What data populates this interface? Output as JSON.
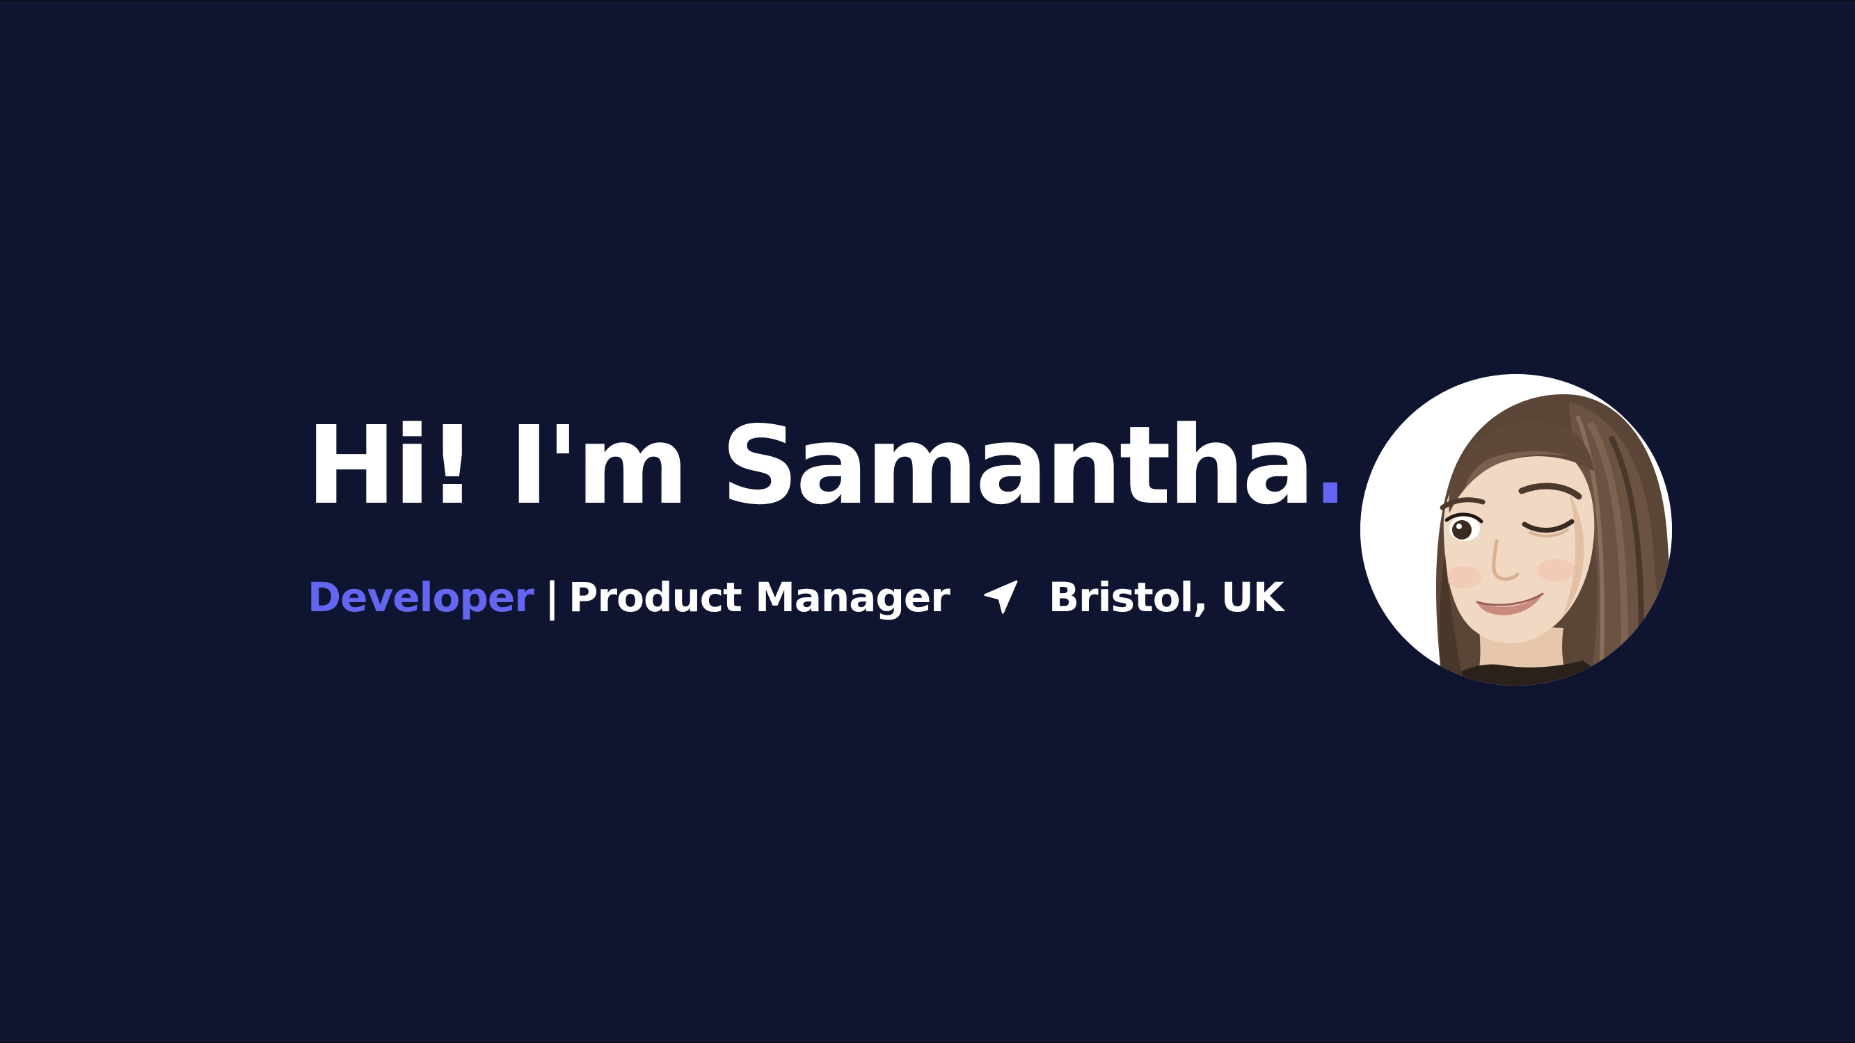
{
  "hero": {
    "greeting": "Hi! I'm Samantha",
    "greeting_dot": ".",
    "role_primary": "Developer",
    "separator": "|",
    "role_secondary": "Product Manager",
    "location": "Bristol, UK",
    "location_icon": "navigation-arrow-icon"
  },
  "avatar": {
    "icon": "memoji-avatar-winking"
  },
  "colors": {
    "background": "#101531",
    "accent": "#6466f1",
    "text": "#ffffff"
  }
}
